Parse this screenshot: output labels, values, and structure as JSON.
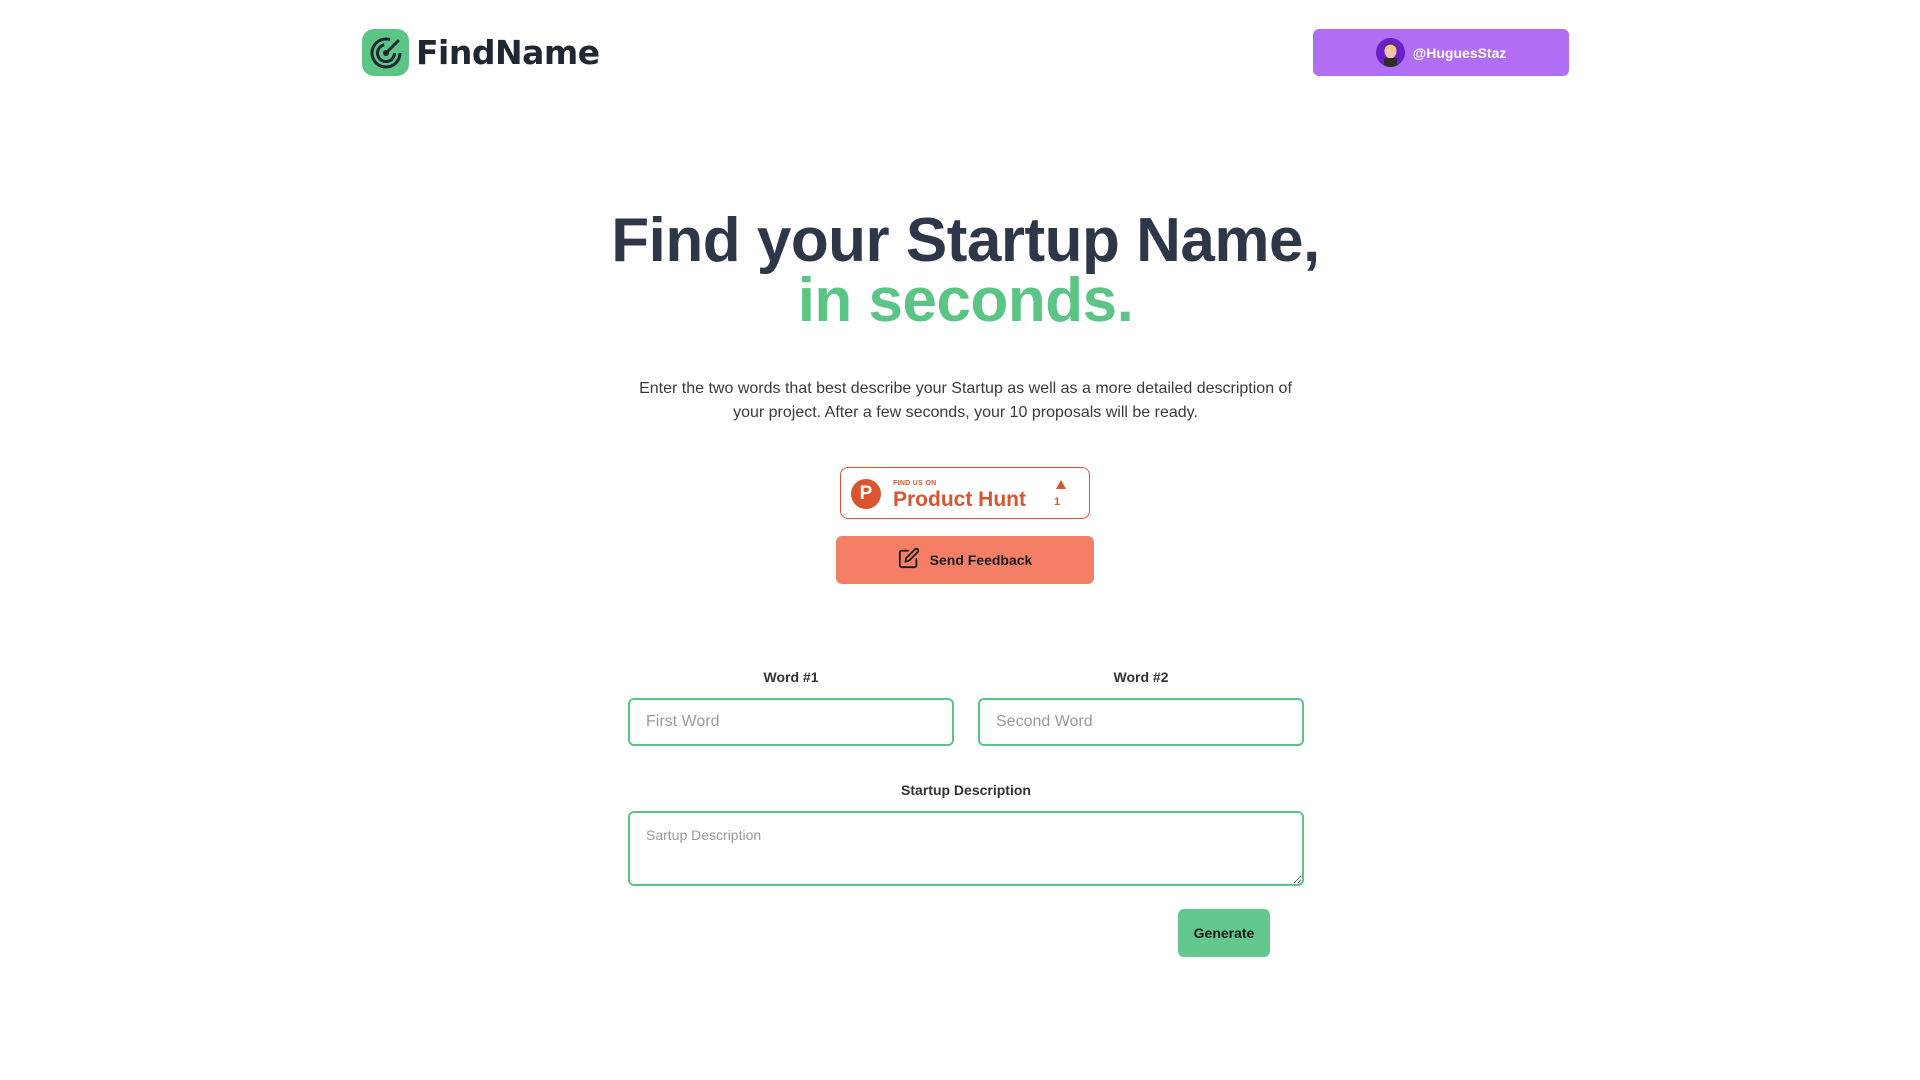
{
  "header": {
    "brand_name": "FindName",
    "user_handle": "@HuguesStaz"
  },
  "hero": {
    "title_line1": "Find your Startup Name,",
    "title_line2": "in seconds.",
    "description": "Enter the two words that best describe your Startup as well as a more detailed description of your project. After a few seconds, your 10 proposals will be ready."
  },
  "product_hunt": {
    "small_text": "FIND US ON",
    "name": "Product Hunt",
    "logo_letter": "P",
    "upvotes": "1"
  },
  "feedback": {
    "label": "Send Feedback"
  },
  "form": {
    "word1_label": "Word #1",
    "word1_placeholder": "First Word",
    "word2_label": "Word #2",
    "word2_placeholder": "Second Word",
    "description_label": "Startup Description",
    "description_placeholder": "Sartup Description",
    "generate_label": "Generate"
  },
  "colors": {
    "brand_green": "#5bc586",
    "user_purple": "#b26df5",
    "product_hunt_orange": "#da552f",
    "feedback_coral": "#f47f66"
  },
  "icons": {
    "logo": "radar-target-icon",
    "feedback": "edit-pencil-icon",
    "upvote": "triangle-up-icon"
  }
}
